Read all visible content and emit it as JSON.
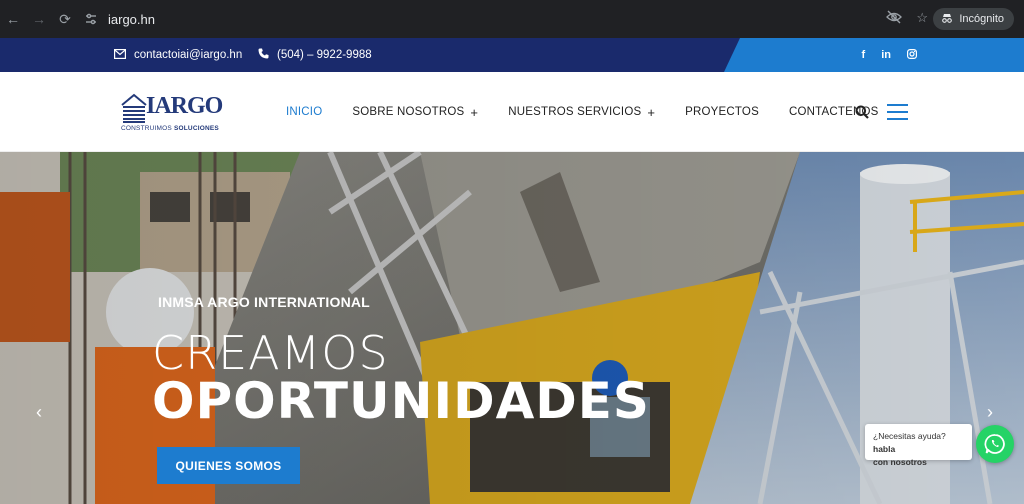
{
  "browser": {
    "url": "iargo.hn",
    "mode_label": "Incógnito"
  },
  "topbar": {
    "email": "contactoiai@iargo.hn",
    "phone": "(504) – 9922-9988",
    "socials": [
      "f",
      "in",
      "instagram-icon"
    ]
  },
  "logo": {
    "word": "IARGO",
    "tagline_regular": "CONSTRUIMOS ",
    "tagline_bold": "SOLUCIONES"
  },
  "nav": {
    "items": [
      {
        "label": "INICIO",
        "has_sub": false,
        "active": true
      },
      {
        "label": "SOBRE NOSOTROS",
        "has_sub": true,
        "active": false
      },
      {
        "label": "NUESTROS SERVICIOS",
        "has_sub": true,
        "active": false
      },
      {
        "label": "PROYECTOS",
        "has_sub": false,
        "active": false
      },
      {
        "label": "CONTACTENOS",
        "has_sub": false,
        "active": false
      }
    ],
    "plus": "+"
  },
  "hero": {
    "kicker": "INMSA ARGO INTERNATIONAL",
    "headline_light": "CREAMOS",
    "headline_bold": "OPORTUNIDADES",
    "cta_label": "QUIENES SOMOS",
    "prev_arrow": "‹",
    "next_arrow": "›"
  },
  "help": {
    "text_regular": "¿Necesitas ayuda? ",
    "text_bold_1": "habla",
    "text_bold_2": "con nosotros"
  },
  "colors": {
    "topbar_dark": "#1a2a6c",
    "topbar_light": "#1d7ccf",
    "accent": "#1d7ccf",
    "whatsapp": "#25d366"
  }
}
